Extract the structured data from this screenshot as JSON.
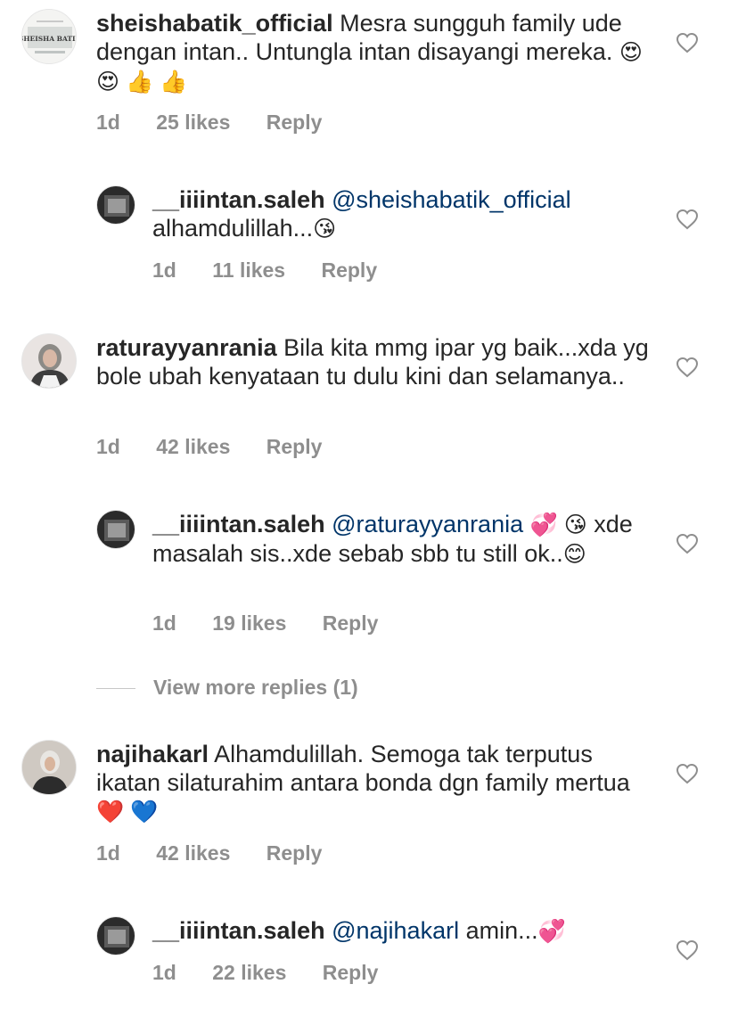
{
  "comments": [
    {
      "username": "sheishabatik_official",
      "text": "Mesra sungguh family ude dengan intan.. Untungla intan disayangi mereka.",
      "emojis": "😍 😍 👍 👍",
      "time": "1d",
      "likes": "25 likes",
      "reply": "Reply",
      "avatar_logo": "SHEISHA BATIK"
    },
    {
      "username": "__iiiintan.saleh",
      "mention": "@sheishabatik_official",
      "text": "alhamdulillah...",
      "emojis": "😘",
      "time": "1d",
      "likes": "11 likes",
      "reply": "Reply"
    },
    {
      "username": "raturayyanrania",
      "text": "Bila kita mmg ipar yg baik...xda yg bole ubah kenyataan tu dulu kini dan selamanya..",
      "time": "1d",
      "likes": "42 likes",
      "reply": "Reply"
    },
    {
      "username": "__iiiintan.saleh",
      "mention": "@raturayyanrania",
      "emojis_after_mention": "💞 😘",
      "text": "xde masalah sis..xde sebab sbb tu still ok..",
      "emojis": "😊",
      "time": "1d",
      "likes": "19 likes",
      "reply": "Reply"
    },
    {
      "username": "najihakarl",
      "text": "Alhamdulillah. Semoga tak terputus ikatan silaturahim antara bonda dgn family mertua",
      "emojis": "❤️ 💙",
      "time": "1d",
      "likes": "42 likes",
      "reply": "Reply"
    },
    {
      "username": "__iiiintan.saleh",
      "mention": "@najihakarl",
      "text": "amin...",
      "emojis": "💞",
      "time": "1d",
      "likes": "22 likes",
      "reply": "Reply"
    }
  ],
  "view_more_replies": "View more replies (1)",
  "icons": {
    "like": "heart-outline-icon"
  },
  "colors": {
    "text": "#262626",
    "meta": "#8e8e8e",
    "mention": "#003569"
  }
}
